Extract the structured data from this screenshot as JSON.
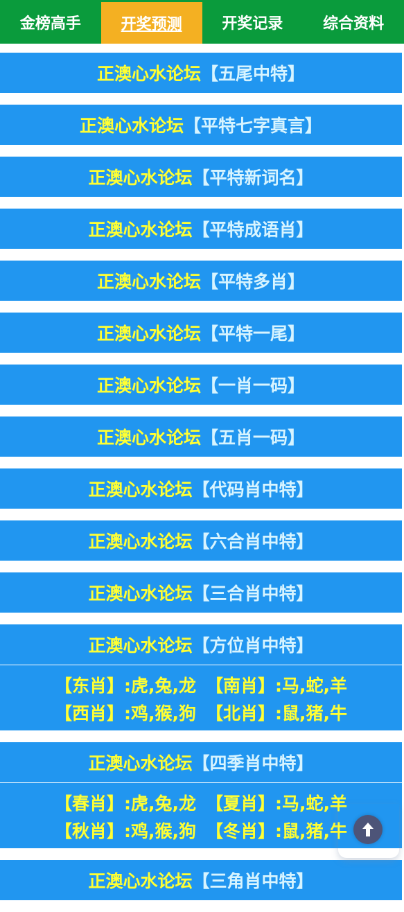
{
  "nav": {
    "tabs": [
      {
        "label": "金榜高手"
      },
      {
        "label": "开奖预测"
      },
      {
        "label": "开奖记录"
      },
      {
        "label": "综合资料"
      }
    ],
    "active_index": 1
  },
  "forum": "正澳心水论坛",
  "topics": [
    {
      "topic": "【五尾中特】"
    },
    {
      "topic": "【平特七字真言】"
    },
    {
      "topic": "【平特新词名】"
    },
    {
      "topic": "【平特成语肖】"
    },
    {
      "topic": "【平特多肖】"
    },
    {
      "topic": "【平特一尾】"
    },
    {
      "topic": "【一肖一码】"
    },
    {
      "topic": "【五肖一码】"
    },
    {
      "topic": "【代码肖中特】"
    },
    {
      "topic": "【六合肖中特】"
    },
    {
      "topic": "【三合肖中特】"
    },
    {
      "topic": "【方位肖中特】",
      "lines": [
        {
          "left": "【东肖】:虎,兔,龙",
          "right": "【南肖】:马,蛇,羊"
        },
        {
          "left": "【西肖】:鸡,猴,狗",
          "right": "【北肖】:鼠,猪,牛"
        }
      ]
    },
    {
      "topic": "【四季肖中特】",
      "lines": [
        {
          "left": "【春肖】:虎,兔,龙",
          "right": "【夏肖】:马,蛇,羊"
        },
        {
          "left": "【秋肖】:鸡,猴,狗",
          "right": "【冬肖】:鼠,猪,牛"
        }
      ]
    },
    {
      "topic": "【三角肖中特】"
    }
  ],
  "colors": {
    "nav_bg": "#0a9b3c",
    "nav_active": "#f4b022",
    "block_bg": "#2196f0",
    "forum_text": "#ffff33",
    "topic_text": "#d7f4ff"
  },
  "back_to_top_icon": "arrow-up-icon"
}
